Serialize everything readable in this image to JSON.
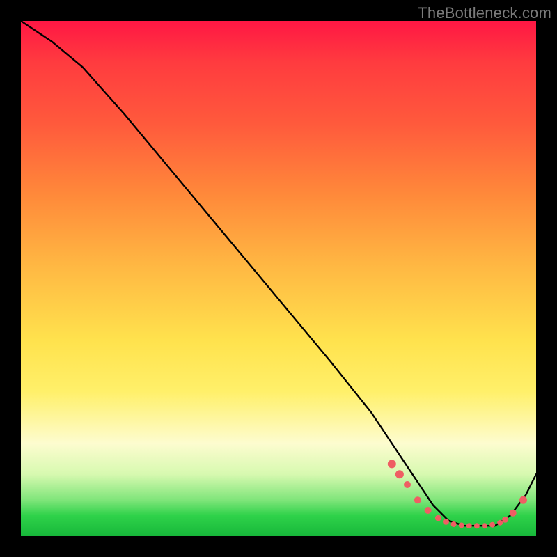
{
  "watermark": "TheBottleneck.com",
  "chart_data": {
    "type": "line",
    "title": "",
    "xlabel": "",
    "ylabel": "",
    "xlim": [
      0,
      100
    ],
    "ylim": [
      0,
      100
    ],
    "grid": false,
    "legend": false,
    "series": [
      {
        "name": "bottleneck-curve",
        "x": [
          0,
          6,
          12,
          20,
          30,
          40,
          50,
          60,
          68,
          72,
          76,
          80,
          83,
          86,
          89,
          92,
          95,
          98,
          100
        ],
        "y": [
          100,
          96,
          91,
          82,
          70,
          58,
          46,
          34,
          24,
          18,
          12,
          6,
          3,
          2,
          2,
          2,
          4,
          8,
          12
        ]
      }
    ],
    "markers": {
      "name": "highlight-dots",
      "color": "#ef5e63",
      "x": [
        72,
        73.5,
        75,
        77,
        79,
        81,
        82.5,
        84,
        85.5,
        87,
        88.5,
        90,
        91.5,
        93,
        94,
        95.5,
        97.5
      ],
      "y": [
        14,
        12,
        10,
        7,
        5,
        3.5,
        2.8,
        2.3,
        2.1,
        2,
        2,
        2,
        2.2,
        2.6,
        3.2,
        4.5,
        7
      ],
      "r": [
        6,
        6,
        5,
        5,
        5,
        4.5,
        4.5,
        4,
        4,
        4,
        4,
        4,
        4,
        4,
        4.5,
        5,
        5.5
      ]
    },
    "gradient_stops": [
      {
        "pos": 0,
        "color": "#ff1744"
      },
      {
        "pos": 34,
        "color": "#ff8a3a"
      },
      {
        "pos": 62,
        "color": "#ffe24d"
      },
      {
        "pos": 85,
        "color": "#f5facc"
      },
      {
        "pos": 100,
        "color": "#17b83a"
      }
    ]
  }
}
